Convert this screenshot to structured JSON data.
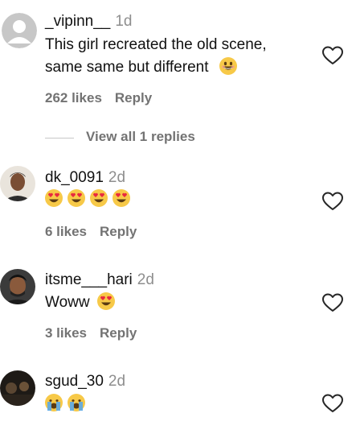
{
  "comments": [
    {
      "username": "_vipinn__",
      "time": "1d",
      "text_line1": "This girl recreated the old scene,",
      "text_line2": "same same but different",
      "likes": "262 likes",
      "reply": "Reply",
      "avatar": "default-avatar"
    },
    {
      "username": "dk_0091",
      "time": "2d",
      "likes": "6 likes",
      "reply": "Reply",
      "avatar": "photo-avatar"
    },
    {
      "username": "itsme___hari",
      "time": "2d",
      "text": "Woww",
      "likes": "3 likes",
      "reply": "Reply",
      "avatar": "photo-avatar"
    },
    {
      "username": "sgud_30",
      "time": "2d",
      "avatar": "photo-avatar"
    }
  ],
  "view_replies": "View all 1 replies",
  "icons": {
    "like": "heart-outline-icon",
    "smile": "grinning-face-emoji",
    "heart_eyes": "heart-eyes-emoji",
    "crying": "crying-face-emoji"
  },
  "colors": {
    "secondary_text": "#737373",
    "timestamp": "#8e8e8e",
    "emoji_yellow": "#f7c948"
  }
}
